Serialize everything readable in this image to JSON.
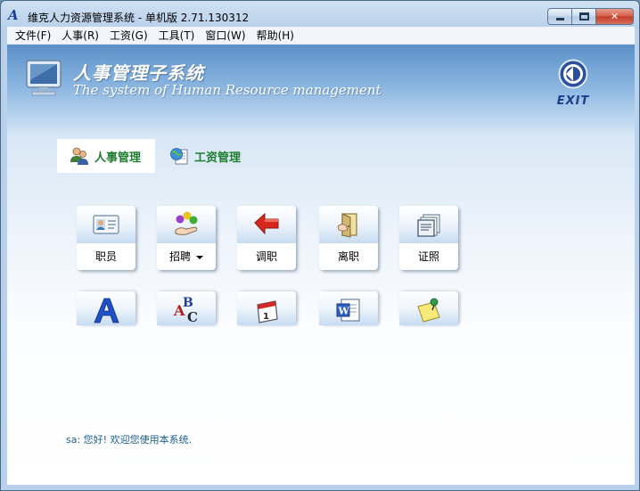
{
  "window": {
    "title": "维克人力资源管理系统 - 单机版 2.71.130312",
    "logo_letter": "A",
    "minimize_label": "minimize",
    "maximize_label": "maximize",
    "close_glyph": "✕"
  },
  "menubar": {
    "items": [
      {
        "label": "文件(F)"
      },
      {
        "label": "人事(R)"
      },
      {
        "label": "工资(G)"
      },
      {
        "label": "工具(T)"
      },
      {
        "label": "窗口(W)"
      },
      {
        "label": "帮助(H)"
      }
    ]
  },
  "banner": {
    "title": "人事管理子系统",
    "subtitle": "The system of Human Resource management",
    "exit_label": "EXIT"
  },
  "tabs": [
    {
      "label": "人事管理",
      "icon": "users-icon",
      "active": true
    },
    {
      "label": "工资管理",
      "icon": "globe-document-icon",
      "active": false
    }
  ],
  "tiles_row1": [
    {
      "label": "职员",
      "icon": "id-card-icon"
    },
    {
      "label": "招聘",
      "icon": "balls-hand-icon",
      "has_dropdown": true
    },
    {
      "label": "调职",
      "icon": "red-arrow-icon"
    },
    {
      "label": "离职",
      "icon": "door-exit-icon"
    },
    {
      "label": "证照",
      "icon": "certificate-stack-icon"
    }
  ],
  "tiles_row2": [
    {
      "label": "",
      "icon": "blue-letter-a-icon"
    },
    {
      "label": "",
      "icon": "abc-icon"
    },
    {
      "label": "",
      "icon": "calendar-icon"
    },
    {
      "label": "",
      "icon": "word-document-icon"
    },
    {
      "label": "",
      "icon": "sticky-note-pin-icon"
    }
  ],
  "status": {
    "text": "sa: 您好! 欢迎您使用本系统."
  },
  "colors": {
    "tab_text": "#1d7d2e",
    "status_text": "#1b5e8f",
    "banner_top": "#5c90c8",
    "close_red": "#c03d27"
  }
}
